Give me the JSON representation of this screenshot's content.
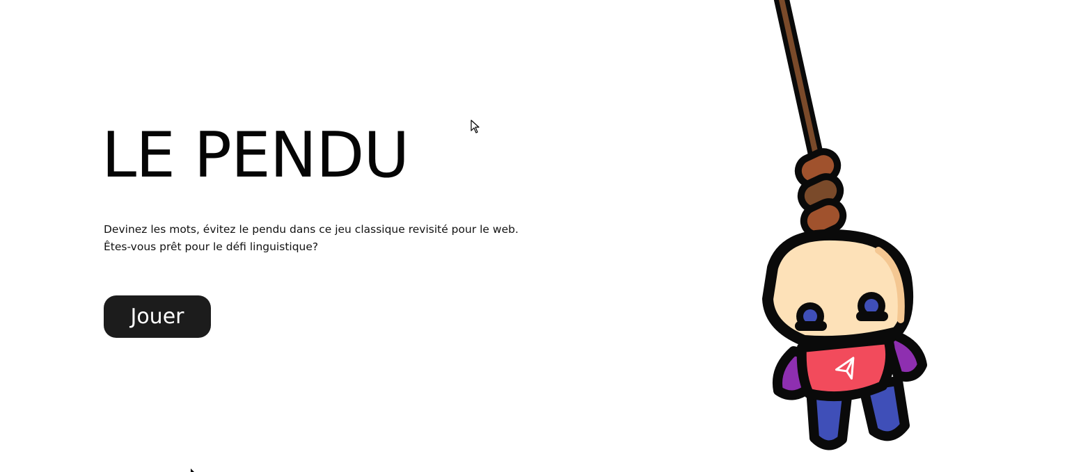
{
  "hero": {
    "title": "LE PENDU",
    "description_line1": "Devinez les mots, évitez le pendu dans ce jeu classique revisité pour le web.",
    "description_line2": "Êtes-vous prêt pour le défi linguistique?",
    "play_label": "Jouer"
  },
  "illustration": {
    "subject": "hanged-character-icon",
    "shirt_emblem": "paper-plane-icon"
  },
  "colors": {
    "background": "#ffffff",
    "button": "#1c1c1c",
    "rope": "#7a4a2a",
    "rope_knot": "#a0522d",
    "skin": "#fde1b8",
    "shirt": "#f24b5c",
    "pants": "#3f4fb8",
    "arms": "#8e2fb0",
    "eyes": "#3f4fb8"
  }
}
